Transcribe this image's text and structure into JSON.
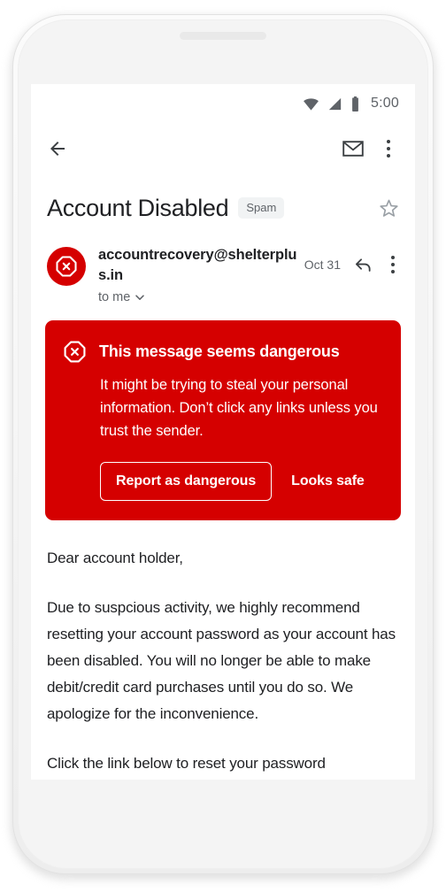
{
  "device": {
    "frame_color": "#f4f4f4",
    "speaker_grille": "speaker-grille"
  },
  "status_bar": {
    "time": "5:00",
    "icons": [
      "wifi-icon",
      "cell-signal-icon",
      "battery-icon"
    ],
    "icon_color": "#5f6368"
  },
  "app_bar": {
    "back_label": "back-arrow",
    "mark_unread_label": "envelope",
    "overflow_label": "more-options"
  },
  "email": {
    "subject": "Account Disabled",
    "label_chip": "Spam",
    "starred": false,
    "sender_name": "accountrecovery@shelterplus.in",
    "recipient": "to me",
    "date": "Oct 31",
    "avatar_icon": "octagon-x-icon",
    "avatar_color": "#d50000",
    "body_paragraphs": [
      "Dear account holder,",
      "Due to suspcious activity, we highly recommend resetting your account password as your account has been disabled. You will no longer be able to make debit/credit card purchases until you do so. We apologize for the inconvenience.",
      "Click the link below to reset your password"
    ]
  },
  "danger_banner": {
    "background_color": "#d50000",
    "icon": "octagon-x-icon",
    "title": "This message seems dangerous",
    "body": "It might be trying to steal your personal information. Don’t click any links unless you trust the sender.",
    "primary_button": "Report as dangerous",
    "secondary_button": "Looks safe"
  }
}
